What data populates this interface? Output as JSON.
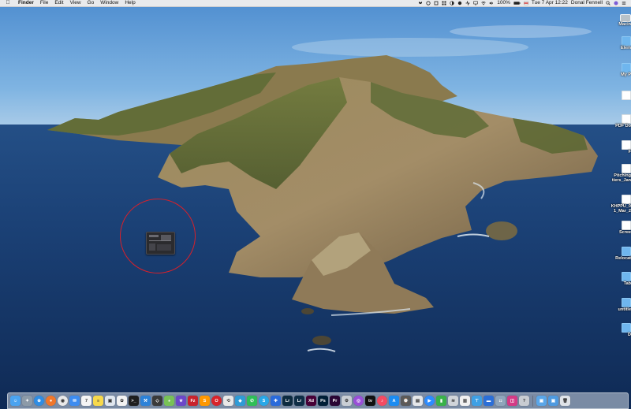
{
  "menubar": {
    "apple_icon": "apple-logo-icon",
    "app_name": "Finder",
    "menus": [
      "File",
      "Edit",
      "View",
      "Go",
      "Window",
      "Help"
    ],
    "battery": "100%",
    "datetime": "Tue 7 Apr  12:22",
    "user": "Donal Fennell"
  },
  "desktop_icons": [
    {
      "label": "Macin",
      "kind": "drive"
    },
    {
      "label": "Elem",
      "kind": "folder"
    },
    {
      "label": "My P",
      "kind": "folder"
    },
    {
      "label": "",
      "kind": "doc"
    },
    {
      "label": "PDF Do",
      "kind": "doc"
    },
    {
      "label": "F",
      "kind": "doc"
    },
    {
      "label": "Pitching\ntiers_Jan",
      "kind": "doc"
    },
    {
      "label": "KHPPU_0\n1_Mar_2",
      "kind": "doc"
    },
    {
      "label": "Scree",
      "kind": "doc"
    },
    {
      "label": "Relocat",
      "kind": "folder"
    },
    {
      "label": "Tab",
      "kind": "folder"
    },
    {
      "label": "untitle",
      "kind": "folder"
    },
    {
      "label": "D",
      "kind": "folder"
    }
  ],
  "dock": {
    "apps": [
      {
        "name": "finder",
        "color": "#4aa3f0",
        "glyph": "☺"
      },
      {
        "name": "launchpad",
        "color": "#8c9aa8",
        "glyph": "✦"
      },
      {
        "name": "safari",
        "color": "#2f8de4",
        "glyph": "⊕"
      },
      {
        "name": "firefox",
        "color": "#f0772b",
        "glyph": "●"
      },
      {
        "name": "chrome",
        "color": "#e8e8e8",
        "glyph": "◉"
      },
      {
        "name": "mail",
        "color": "#3d8cf0",
        "glyph": "✉"
      },
      {
        "name": "calendar",
        "color": "#f5f5f5",
        "glyph": "7"
      },
      {
        "name": "notes",
        "color": "#f7d94c",
        "glyph": "≡"
      },
      {
        "name": "preview",
        "color": "#dfe6ee",
        "glyph": "▣"
      },
      {
        "name": "photos",
        "color": "#f2f2f2",
        "glyph": "✿"
      },
      {
        "name": "terminal",
        "color": "#1e1e1e",
        "glyph": ">_"
      },
      {
        "name": "xcode",
        "color": "#2c82d9",
        "glyph": "⚒"
      },
      {
        "name": "unity",
        "color": "#3a3a3a",
        "glyph": "◇"
      },
      {
        "name": "android-studio",
        "color": "#78c257",
        "glyph": "◕"
      },
      {
        "name": "imovie",
        "color": "#6c47c9",
        "glyph": "★"
      },
      {
        "name": "filezilla",
        "color": "#c8232c",
        "glyph": "Fz"
      },
      {
        "name": "sublime",
        "color": "#ff9800",
        "glyph": "S"
      },
      {
        "name": "opera",
        "color": "#d8232a",
        "glyph": "O"
      },
      {
        "name": "git-app",
        "color": "#e8e8e8",
        "glyph": "⟲"
      },
      {
        "name": "colour-app",
        "color": "#2f9bd6",
        "glyph": "◆"
      },
      {
        "name": "whatsapp",
        "color": "#2fbf57",
        "glyph": "✆"
      },
      {
        "name": "skype",
        "color": "#28a8e8",
        "glyph": "S"
      },
      {
        "name": "blue-app",
        "color": "#2a6bdb",
        "glyph": "✚"
      },
      {
        "name": "lightroom-classic",
        "color": "#0d2b40",
        "glyph": "Lr"
      },
      {
        "name": "lightroom",
        "color": "#0e2d46",
        "glyph": "Lr"
      },
      {
        "name": "adobe-xd",
        "color": "#470137",
        "glyph": "Xd"
      },
      {
        "name": "photoshop",
        "color": "#001e36",
        "glyph": "Ps"
      },
      {
        "name": "premiere",
        "color": "#2a0634",
        "glyph": "Pr"
      },
      {
        "name": "gear-app",
        "color": "#c9ced4",
        "glyph": "⚙"
      },
      {
        "name": "podcasts",
        "color": "#9a4fd8",
        "glyph": "◎"
      },
      {
        "name": "apple-tv",
        "color": "#111111",
        "glyph": "tv"
      },
      {
        "name": "music",
        "color": "#f44b63",
        "glyph": "♪"
      },
      {
        "name": "app-store",
        "color": "#1b8cf2",
        "glyph": "A"
      },
      {
        "name": "screen-time",
        "color": "#5a5a5a",
        "glyph": "⌚"
      },
      {
        "name": "printer",
        "color": "#e5e7ea",
        "glyph": "▤"
      },
      {
        "name": "zoom",
        "color": "#2d8cff",
        "glyph": "▶"
      },
      {
        "name": "green-app",
        "color": "#39b24a",
        "glyph": "▮"
      },
      {
        "name": "wifi-util",
        "color": "#d0d4d9",
        "glyph": "≋"
      },
      {
        "name": "stats-app",
        "color": "#f0f0f0",
        "glyph": "▥"
      },
      {
        "name": "desk-app",
        "color": "#3ea0e5",
        "glyph": "⊤"
      },
      {
        "name": "keynote",
        "color": "#2b6fd8",
        "glyph": "▬"
      },
      {
        "name": "image-capture",
        "color": "#8fa5bb",
        "glyph": "◘"
      },
      {
        "name": "pink-app",
        "color": "#d33a86",
        "glyph": "◫"
      },
      {
        "name": "help-app",
        "color": "#c8ccd2",
        "glyph": "?"
      }
    ],
    "recent": [
      {
        "name": "blue-window-a",
        "color": "#5aa6e8",
        "glyph": "▣"
      },
      {
        "name": "blue-window-b",
        "color": "#4e9ae0",
        "glyph": "▣"
      },
      {
        "name": "trash",
        "color": "#dfe3e8",
        "glyph": "🗑"
      }
    ]
  },
  "colors": {
    "annotation": "#d8202a",
    "sky": "#6aa6d9",
    "sea": "#17386a"
  }
}
